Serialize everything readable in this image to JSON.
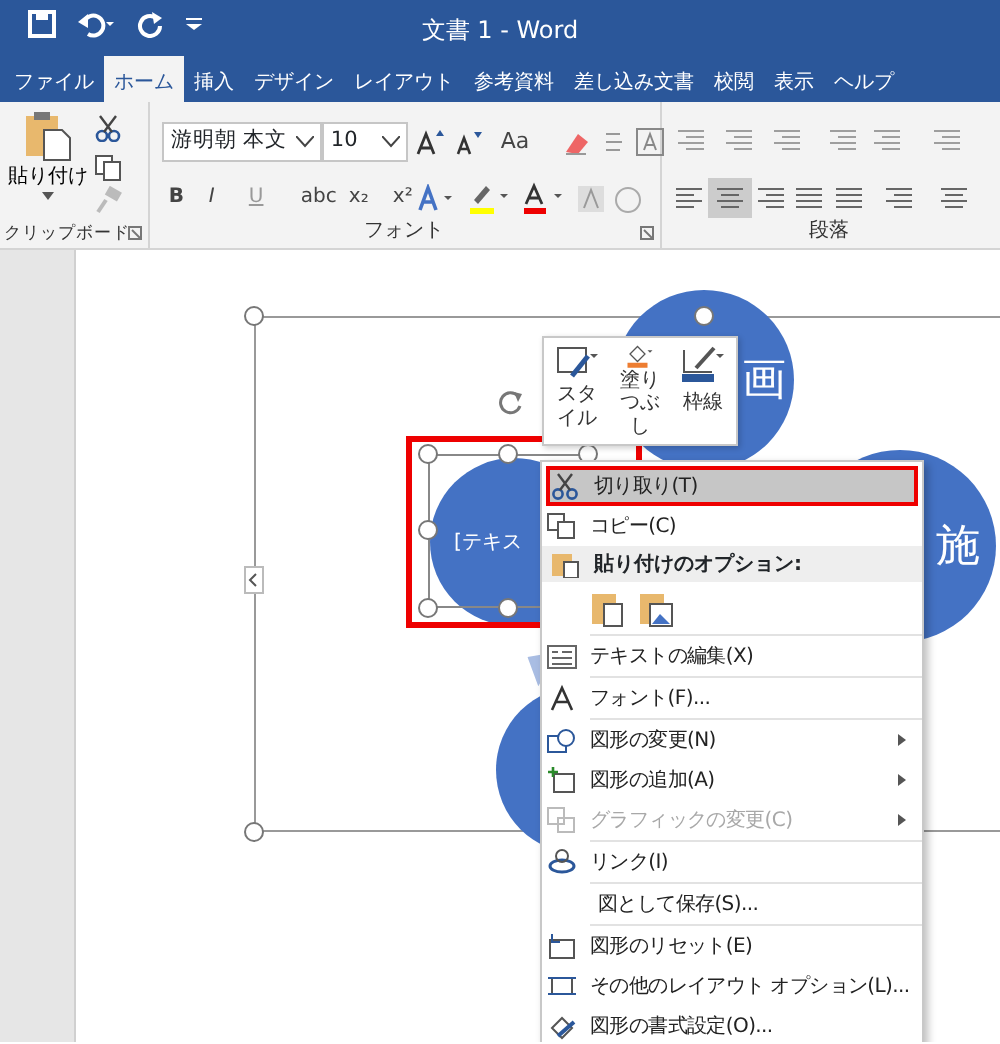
{
  "window": {
    "title": "文書 1 - Word"
  },
  "tabs": [
    {
      "label": "ファイル",
      "selected": false
    },
    {
      "label": "ホーム",
      "selected": true
    },
    {
      "label": "挿入",
      "selected": false
    },
    {
      "label": "デザイン",
      "selected": false
    },
    {
      "label": "レイアウト",
      "selected": false
    },
    {
      "label": "参考資料",
      "selected": false
    },
    {
      "label": "差し込み文書",
      "selected": false
    },
    {
      "label": "校閲",
      "selected": false
    },
    {
      "label": "表示",
      "selected": false
    },
    {
      "label": "ヘルプ",
      "selected": false
    }
  ],
  "ribbon": {
    "paste_label": "貼り付け",
    "font_name": "游明朝 本文",
    "font_size": "10",
    "change_case": "Aa",
    "format_buttons": [
      "B",
      "I",
      "U",
      "abc",
      "x₂",
      "x²"
    ],
    "groups": [
      "クリップボード",
      "フォント",
      "段落"
    ]
  },
  "diagram": {
    "shapes": [
      {
        "text": "画"
      },
      {
        "text": "施"
      },
      {
        "text": "[テキス"
      }
    ]
  },
  "mini_toolbar": [
    "スタイル",
    "塗りつぶし",
    "枠線"
  ],
  "context_menu": [
    {
      "kind": "item",
      "label": "切り取り(T)",
      "highlighted": true,
      "disabled": false,
      "submenu": false
    },
    {
      "kind": "item",
      "label": "コピー(C)",
      "highlighted": false,
      "disabled": false,
      "submenu": false
    },
    {
      "kind": "header",
      "label": "貼り付けのオプション:"
    },
    {
      "kind": "paste_options"
    },
    {
      "kind": "item",
      "label": "テキストの編集(X)",
      "highlighted": false,
      "disabled": false,
      "submenu": false
    },
    {
      "kind": "item",
      "label": "フォント(F)...",
      "highlighted": false,
      "disabled": false,
      "submenu": false
    },
    {
      "kind": "item",
      "label": "図形の変更(N)",
      "highlighted": false,
      "disabled": false,
      "submenu": true
    },
    {
      "kind": "item",
      "label": "図形の追加(A)",
      "highlighted": false,
      "disabled": false,
      "submenu": true
    },
    {
      "kind": "item",
      "label": "グラフィックの変更(C)",
      "highlighted": false,
      "disabled": true,
      "submenu": true
    },
    {
      "kind": "item",
      "label": "リンク(I)",
      "highlighted": false,
      "disabled": false,
      "submenu": false
    },
    {
      "kind": "item",
      "label": "図として保存(S)...",
      "highlighted": false,
      "disabled": false,
      "submenu": false
    },
    {
      "kind": "item",
      "label": "図形のリセット(E)",
      "highlighted": false,
      "disabled": false,
      "submenu": false
    },
    {
      "kind": "item",
      "label": "その他のレイアウト オプション(L)...",
      "highlighted": false,
      "disabled": false,
      "submenu": false
    },
    {
      "kind": "item",
      "label": "図形の書式設定(O)...",
      "highlighted": false,
      "disabled": false,
      "submenu": false
    }
  ]
}
